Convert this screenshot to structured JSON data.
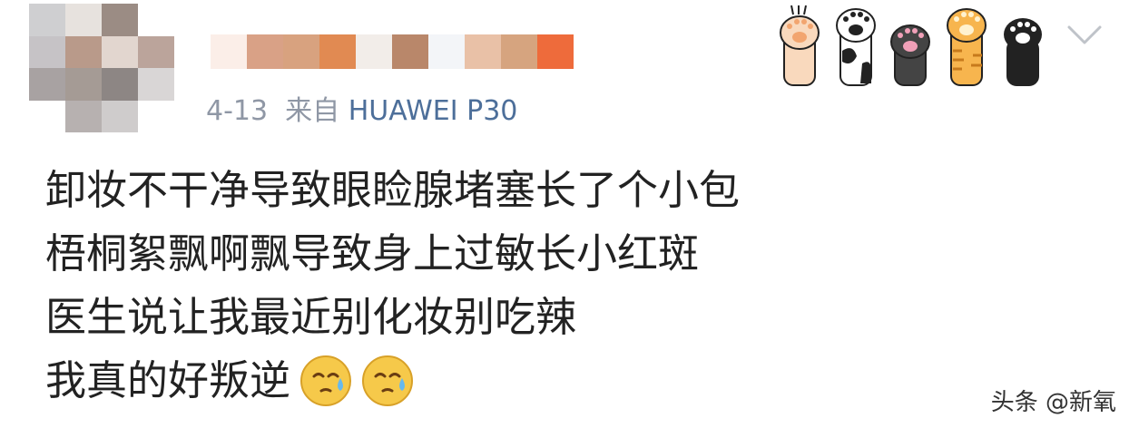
{
  "post": {
    "date": "4-13",
    "source_prefix": "来自",
    "source_device": "HUAWEI P30",
    "lines": [
      "卸妆不干净导致眼睑腺堵塞长了个小包",
      "梧桐絮飘啊飘导致身上过敏长小红斑",
      "医生说让我最近别化妆别吃辣"
    ],
    "last_line": "我真的好叛逆",
    "emoji_names": [
      "sweat-face-emoji",
      "sweat-face-emoji"
    ]
  },
  "author": {
    "avatar": "pixelated-avatar",
    "name": "pixelated-username"
  },
  "watermark": "头条 @新氧",
  "colors": {
    "meta": "#8f97a5",
    "link": "#4d6f9a",
    "text": "#222222",
    "chevron": "#bfc3c9"
  }
}
